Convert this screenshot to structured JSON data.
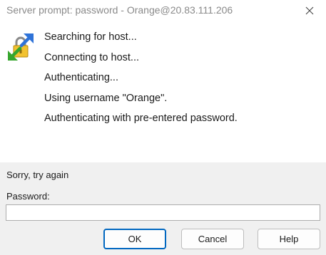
{
  "window": {
    "title": "Server prompt: password - Orange@20.83.111.206",
    "close_icon": "close-icon",
    "app_icon": "putty-key-icon"
  },
  "log": {
    "messages": [
      "Searching for host...",
      "Connecting to host...",
      "Authenticating...",
      "Using username \"Orange\".",
      "Authenticating with pre-entered password."
    ]
  },
  "prompt": {
    "status": "Sorry, try again",
    "password_label": "Password:",
    "password_value": ""
  },
  "buttons": {
    "ok": "OK",
    "cancel": "Cancel",
    "help": "Help"
  },
  "colors": {
    "accent": "#0067c0",
    "panel_bg": "#f0f0f0",
    "title_text": "#8a8a8a"
  }
}
